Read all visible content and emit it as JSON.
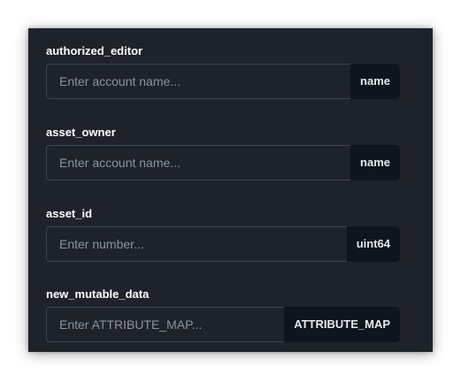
{
  "fields": [
    {
      "label": "authorized_editor",
      "placeholder": "Enter account name...",
      "value": "",
      "type": "name"
    },
    {
      "label": "asset_owner",
      "placeholder": "Enter account name...",
      "value": "",
      "type": "name"
    },
    {
      "label": "asset_id",
      "placeholder": "Enter number...",
      "value": "",
      "type": "uint64"
    },
    {
      "label": "new_mutable_data",
      "placeholder": "Enter ATTRIBUTE_MAP...",
      "value": "",
      "type": "ATTRIBUTE_MAP"
    }
  ],
  "colors": {
    "panel_background": "#1e232b",
    "input_border": "#3d444f",
    "badge_background": "#0f151e",
    "label_text": "#ffffff",
    "placeholder_text": "#8b929c"
  }
}
